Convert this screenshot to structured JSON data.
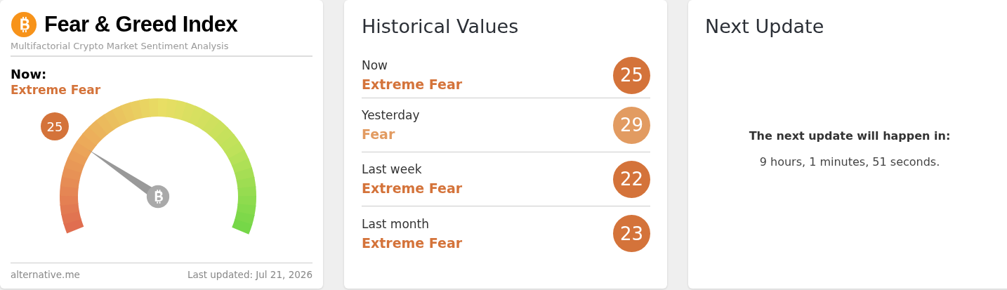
{
  "index_card": {
    "title": "Fear & Greed Index",
    "subtitle": "Multifactorial Crypto Market Sentiment Analysis",
    "now_label": "Now:",
    "now_status": "Extreme Fear",
    "gauge": {
      "value": "25"
    },
    "footer_source": "alternative.me",
    "footer_updated": "Last updated: Jul 21, 2026"
  },
  "history": {
    "title": "Historical Values",
    "rows": [
      {
        "period": "Now",
        "status": "Extreme Fear",
        "value": "25",
        "color": "#d4733a"
      },
      {
        "period": "Yesterday",
        "status": "Fear",
        "value": "29",
        "color": "#e29b61"
      },
      {
        "period": "Last week",
        "status": "Extreme Fear",
        "value": "22",
        "color": "#d4733a"
      },
      {
        "period": "Last month",
        "status": "Extreme Fear",
        "value": "23",
        "color": "#d4733a"
      }
    ]
  },
  "next_update": {
    "title": "Next Update",
    "heading": "The next update will happen in:",
    "countdown": "9 hours, 1 minutes, 51 seconds."
  }
}
